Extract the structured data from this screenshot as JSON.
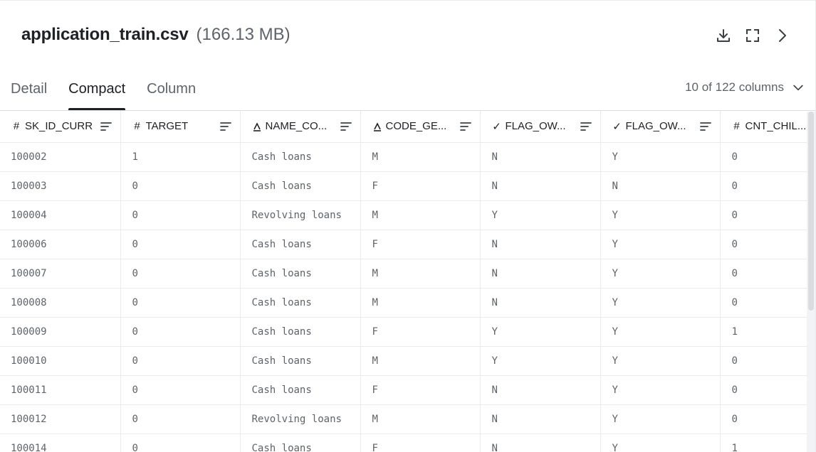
{
  "file": {
    "name": "application_train.csv",
    "size": "(166.13 MB)"
  },
  "actions": [
    {
      "name": "download-icon"
    },
    {
      "name": "fullscreen-icon"
    },
    {
      "name": "chevron-right-icon"
    }
  ],
  "tabs": [
    {
      "label": "Detail",
      "active": false
    },
    {
      "label": "Compact",
      "active": true
    },
    {
      "label": "Column",
      "active": false
    }
  ],
  "columns_count": "10 of 122 columns",
  "table": {
    "headers": [
      {
        "type_icon": "#",
        "type": "numeric",
        "label": "SK_ID_CURR"
      },
      {
        "type_icon": "#",
        "type": "numeric",
        "label": "TARGET"
      },
      {
        "type_icon": "A",
        "type": "string",
        "label": "NAME_CO..."
      },
      {
        "type_icon": "A",
        "type": "string",
        "label": "CODE_GE..."
      },
      {
        "type_icon": "✓",
        "type": "boolean",
        "label": "FLAG_OW..."
      },
      {
        "type_icon": "✓",
        "type": "boolean",
        "label": "FLAG_OW..."
      },
      {
        "type_icon": "#",
        "type": "numeric",
        "label": "CNT_CHIL..."
      }
    ],
    "rows": [
      [
        "100002",
        "1",
        "Cash loans",
        "M",
        "N",
        "Y",
        "0"
      ],
      [
        "100003",
        "0",
        "Cash loans",
        "F",
        "N",
        "N",
        "0"
      ],
      [
        "100004",
        "0",
        "Revolving loans",
        "M",
        "Y",
        "Y",
        "0"
      ],
      [
        "100006",
        "0",
        "Cash loans",
        "F",
        "N",
        "Y",
        "0"
      ],
      [
        "100007",
        "0",
        "Cash loans",
        "M",
        "N",
        "Y",
        "0"
      ],
      [
        "100008",
        "0",
        "Cash loans",
        "M",
        "N",
        "Y",
        "0"
      ],
      [
        "100009",
        "0",
        "Cash loans",
        "F",
        "Y",
        "Y",
        "1"
      ],
      [
        "100010",
        "0",
        "Cash loans",
        "M",
        "Y",
        "Y",
        "0"
      ],
      [
        "100011",
        "0",
        "Cash loans",
        "F",
        "N",
        "Y",
        "0"
      ],
      [
        "100012",
        "0",
        "Revolving loans",
        "M",
        "N",
        "Y",
        "0"
      ],
      [
        "100014",
        "0",
        "Cash loans",
        "F",
        "N",
        "Y",
        "1"
      ]
    ]
  },
  "colors": {
    "text": "#202124",
    "muted": "#5f6368",
    "border": "#e8eaed"
  }
}
